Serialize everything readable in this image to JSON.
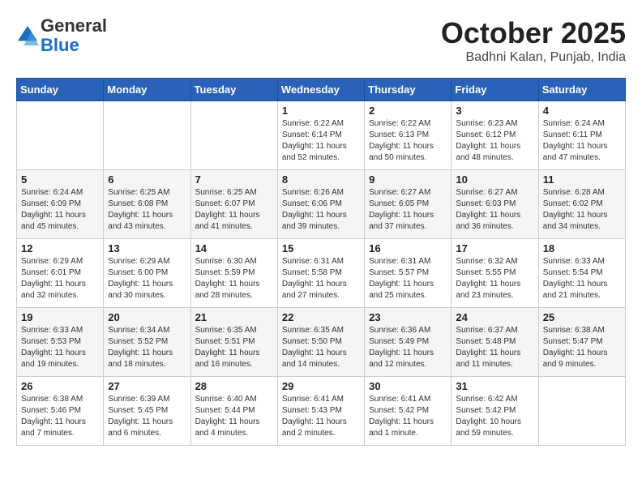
{
  "logo": {
    "general": "General",
    "blue": "Blue"
  },
  "header": {
    "month": "October 2025",
    "location": "Badhni Kalan, Punjab, India"
  },
  "weekdays": [
    "Sunday",
    "Monday",
    "Tuesday",
    "Wednesday",
    "Thursday",
    "Friday",
    "Saturday"
  ],
  "weeks": [
    [
      {
        "day": "",
        "info": ""
      },
      {
        "day": "",
        "info": ""
      },
      {
        "day": "",
        "info": ""
      },
      {
        "day": "1",
        "info": "Sunrise: 6:22 AM\nSunset: 6:14 PM\nDaylight: 11 hours\nand 52 minutes."
      },
      {
        "day": "2",
        "info": "Sunrise: 6:22 AM\nSunset: 6:13 PM\nDaylight: 11 hours\nand 50 minutes."
      },
      {
        "day": "3",
        "info": "Sunrise: 6:23 AM\nSunset: 6:12 PM\nDaylight: 11 hours\nand 48 minutes."
      },
      {
        "day": "4",
        "info": "Sunrise: 6:24 AM\nSunset: 6:11 PM\nDaylight: 11 hours\nand 47 minutes."
      }
    ],
    [
      {
        "day": "5",
        "info": "Sunrise: 6:24 AM\nSunset: 6:09 PM\nDaylight: 11 hours\nand 45 minutes."
      },
      {
        "day": "6",
        "info": "Sunrise: 6:25 AM\nSunset: 6:08 PM\nDaylight: 11 hours\nand 43 minutes."
      },
      {
        "day": "7",
        "info": "Sunrise: 6:25 AM\nSunset: 6:07 PM\nDaylight: 11 hours\nand 41 minutes."
      },
      {
        "day": "8",
        "info": "Sunrise: 6:26 AM\nSunset: 6:06 PM\nDaylight: 11 hours\nand 39 minutes."
      },
      {
        "day": "9",
        "info": "Sunrise: 6:27 AM\nSunset: 6:05 PM\nDaylight: 11 hours\nand 37 minutes."
      },
      {
        "day": "10",
        "info": "Sunrise: 6:27 AM\nSunset: 6:03 PM\nDaylight: 11 hours\nand 36 minutes."
      },
      {
        "day": "11",
        "info": "Sunrise: 6:28 AM\nSunset: 6:02 PM\nDaylight: 11 hours\nand 34 minutes."
      }
    ],
    [
      {
        "day": "12",
        "info": "Sunrise: 6:29 AM\nSunset: 6:01 PM\nDaylight: 11 hours\nand 32 minutes."
      },
      {
        "day": "13",
        "info": "Sunrise: 6:29 AM\nSunset: 6:00 PM\nDaylight: 11 hours\nand 30 minutes."
      },
      {
        "day": "14",
        "info": "Sunrise: 6:30 AM\nSunset: 5:59 PM\nDaylight: 11 hours\nand 28 minutes."
      },
      {
        "day": "15",
        "info": "Sunrise: 6:31 AM\nSunset: 5:58 PM\nDaylight: 11 hours\nand 27 minutes."
      },
      {
        "day": "16",
        "info": "Sunrise: 6:31 AM\nSunset: 5:57 PM\nDaylight: 11 hours\nand 25 minutes."
      },
      {
        "day": "17",
        "info": "Sunrise: 6:32 AM\nSunset: 5:55 PM\nDaylight: 11 hours\nand 23 minutes."
      },
      {
        "day": "18",
        "info": "Sunrise: 6:33 AM\nSunset: 5:54 PM\nDaylight: 11 hours\nand 21 minutes."
      }
    ],
    [
      {
        "day": "19",
        "info": "Sunrise: 6:33 AM\nSunset: 5:53 PM\nDaylight: 11 hours\nand 19 minutes."
      },
      {
        "day": "20",
        "info": "Sunrise: 6:34 AM\nSunset: 5:52 PM\nDaylight: 11 hours\nand 18 minutes."
      },
      {
        "day": "21",
        "info": "Sunrise: 6:35 AM\nSunset: 5:51 PM\nDaylight: 11 hours\nand 16 minutes."
      },
      {
        "day": "22",
        "info": "Sunrise: 6:35 AM\nSunset: 5:50 PM\nDaylight: 11 hours\nand 14 minutes."
      },
      {
        "day": "23",
        "info": "Sunrise: 6:36 AM\nSunset: 5:49 PM\nDaylight: 11 hours\nand 12 minutes."
      },
      {
        "day": "24",
        "info": "Sunrise: 6:37 AM\nSunset: 5:48 PM\nDaylight: 11 hours\nand 11 minutes."
      },
      {
        "day": "25",
        "info": "Sunrise: 6:38 AM\nSunset: 5:47 PM\nDaylight: 11 hours\nand 9 minutes."
      }
    ],
    [
      {
        "day": "26",
        "info": "Sunrise: 6:38 AM\nSunset: 5:46 PM\nDaylight: 11 hours\nand 7 minutes."
      },
      {
        "day": "27",
        "info": "Sunrise: 6:39 AM\nSunset: 5:45 PM\nDaylight: 11 hours\nand 6 minutes."
      },
      {
        "day": "28",
        "info": "Sunrise: 6:40 AM\nSunset: 5:44 PM\nDaylight: 11 hours\nand 4 minutes."
      },
      {
        "day": "29",
        "info": "Sunrise: 6:41 AM\nSunset: 5:43 PM\nDaylight: 11 hours\nand 2 minutes."
      },
      {
        "day": "30",
        "info": "Sunrise: 6:41 AM\nSunset: 5:42 PM\nDaylight: 11 hours\nand 1 minute."
      },
      {
        "day": "31",
        "info": "Sunrise: 6:42 AM\nSunset: 5:42 PM\nDaylight: 10 hours\nand 59 minutes."
      },
      {
        "day": "",
        "info": ""
      }
    ]
  ]
}
